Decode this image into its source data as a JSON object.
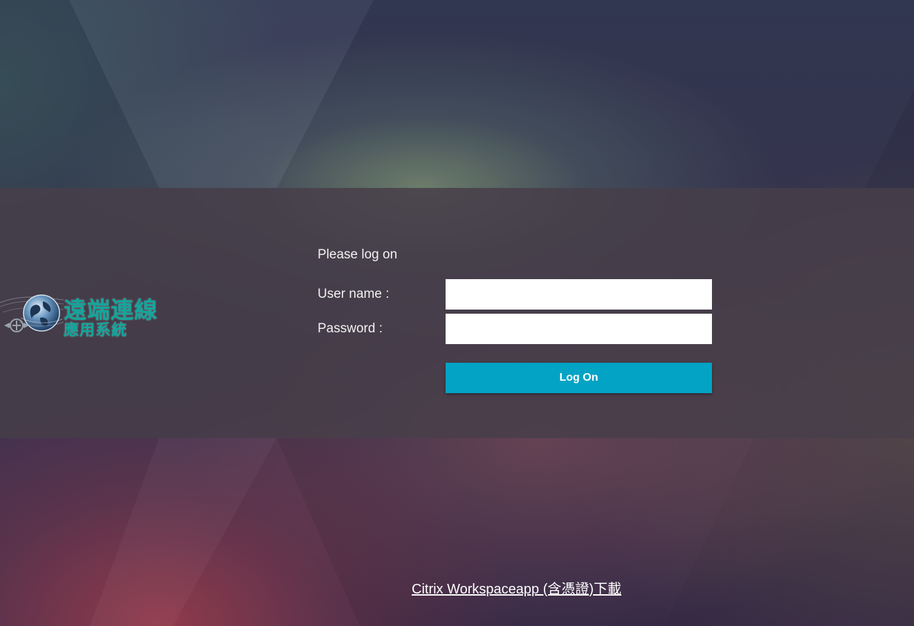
{
  "brand": {
    "title_line1": "遠端連線",
    "title_line2": "應用系統",
    "icon": "globe-icon",
    "emblem_icon": "postal-emblem-icon",
    "color": "#12a69c"
  },
  "login": {
    "prompt": "Please log on",
    "username_label": "User name :",
    "username_value": "",
    "password_label": "Password :",
    "password_value": "",
    "submit_label": "Log On",
    "accent_color": "#02a3c4"
  },
  "footer": {
    "download_link": "Citrix Workspaceapp (含憑證)下載"
  }
}
